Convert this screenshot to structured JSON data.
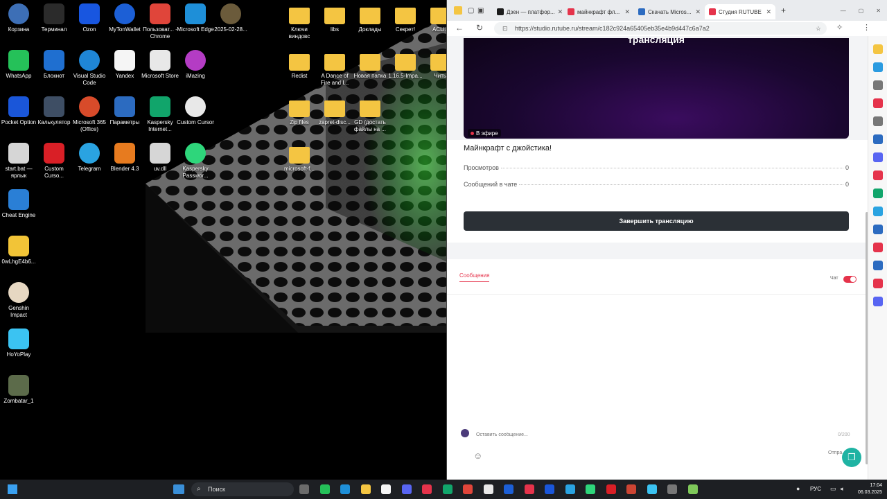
{
  "desktop": {
    "icons": [
      {
        "label": "Корзина",
        "color": "#3d6fb6"
      },
      {
        "label": "Терминал",
        "color": "#2b2b2b"
      },
      {
        "label": "Ozon",
        "color": "#1856e0"
      },
      {
        "label": "MyTonWallet",
        "color": "#1c5fd6"
      },
      {
        "label": "Пользоват... - Chrome",
        "color": "#e0453a"
      },
      {
        "label": "Microsoft Edge",
        "color": "#1e8fd8"
      },
      {
        "label": "2025-02-28...",
        "color": "#6b5b3b"
      },
      {
        "label": "WhatsApp",
        "color": "#25c159"
      },
      {
        "label": "Блокнот",
        "color": "#1f6fd0"
      },
      {
        "label": "Visual Studio Code",
        "color": "#1f86d6"
      },
      {
        "label": "Yandex",
        "color": "#f5f5f5"
      },
      {
        "label": "Microsoft Store",
        "color": "#e8e8e8"
      },
      {
        "label": "iMazing",
        "color": "#b43cc4"
      },
      {
        "label": "Pocket Option",
        "color": "#1a56d9"
      },
      {
        "label": "Калькулятор",
        "color": "#3e4e64"
      },
      {
        "label": "Microsoft 365 (Office)",
        "color": "#d84b2a"
      },
      {
        "label": "Параметры",
        "color": "#2c6bc0"
      },
      {
        "label": "Kaspersky Internet...",
        "color": "#11a56b"
      },
      {
        "label": "Custom Cursor",
        "color": "#e8e8e8"
      },
      {
        "label": "start.bat — ярлык",
        "color": "#d6d6d6"
      },
      {
        "label": "Custom Curso...",
        "color": "#d91f26"
      },
      {
        "label": "Telegram",
        "color": "#2aa3e1"
      },
      {
        "label": "Blender 4.3",
        "color": "#e77b1f"
      },
      {
        "label": "uv.dll",
        "color": "#d6d6d6"
      },
      {
        "label": "Kaspersky Passwor...",
        "color": "#2ed67b"
      },
      {
        "label": "Cheat Engine",
        "color": "#2a7fd6"
      },
      {
        "label": "0wLhgE4b6...",
        "color": "#f2c437"
      },
      {
        "label": "Genshin Impact",
        "color": "#e6d7c2"
      },
      {
        "label": "HoYoPlay",
        "color": "#3bc3f2"
      },
      {
        "label": "Zombatar_1",
        "color": "#5c6b4a"
      }
    ],
    "folders": [
      {
        "label": "Ключи виндовс"
      },
      {
        "label": "libs"
      },
      {
        "label": "Доклады"
      },
      {
        "label": "Секрет!"
      },
      {
        "label": "ACLi..."
      },
      {
        "label": "Redist"
      },
      {
        "label": "A Dance of Fire and I..."
      },
      {
        "label": "Новая папка"
      },
      {
        "label": "1.16.5-Impa..."
      },
      {
        "label": "Читы"
      },
      {
        "label": "Zip files"
      },
      {
        "label": "zapret-disc..."
      },
      {
        "label": "GD (достать файлы на ..."
      },
      {
        "label": "microsoft-f..."
      }
    ]
  },
  "browser": {
    "tabs": [
      {
        "label": "Дзен — платфор...",
        "color": "#1b1b1b",
        "active": false
      },
      {
        "label": "майнкрафт фл...",
        "color": "#e5334b",
        "active": false
      },
      {
        "label": "Скачать Micros...",
        "color": "#2c6bc0",
        "active": false
      },
      {
        "label": "Студия RUTUBE",
        "color": "#e5334b",
        "active": true
      }
    ],
    "new_tab": "+",
    "url": "https://studio.rutube.ru/stream/c182c924a65405eb35e4b9d447c6a7a2",
    "stream": {
      "preview_title": "трансляция",
      "live_badge": "В эфире",
      "name": "Майнкрафт с джойстика!",
      "stats": [
        {
          "label": "Просмотров",
          "value": "0"
        },
        {
          "label": "Сообщений в чате",
          "value": "0"
        }
      ],
      "end_button": "Завершить трансляцию"
    },
    "chat": {
      "tab_label": "Сообщения",
      "toggle_label": "Чат",
      "toggle_on": true,
      "input_placeholder": "Оставить сообщение...",
      "counter": "0/200",
      "send_label": "Отпра..."
    }
  },
  "taskbar": {
    "search_placeholder": "Поиск",
    "language": "РУС",
    "time": "17:04",
    "date": "06.03.2025"
  }
}
